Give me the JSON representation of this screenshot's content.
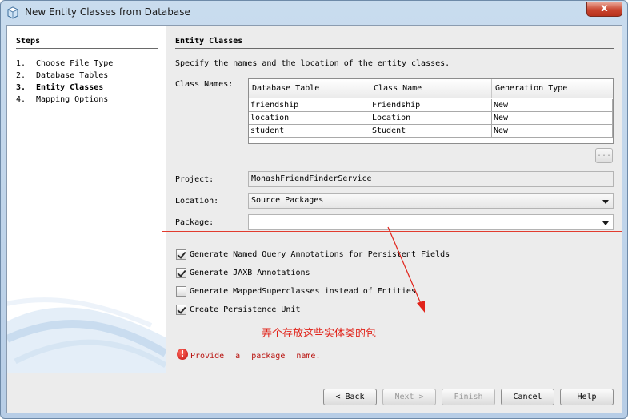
{
  "window": {
    "title": "New Entity Classes from Database",
    "close_glyph": "x"
  },
  "steps": {
    "title": "Steps",
    "items": [
      {
        "num": "1.",
        "label": "Choose File Type"
      },
      {
        "num": "2.",
        "label": "Database Tables"
      },
      {
        "num": "3.",
        "label": "Entity Classes"
      },
      {
        "num": "4.",
        "label": "Mapping Options"
      }
    ]
  },
  "panel": {
    "title": "Entity Classes",
    "instructions": "Specify the names and the location of the entity classes.",
    "class_names_label": "Class Names:",
    "table": {
      "columns": [
        "Database Table",
        "Class Name",
        "Generation Type"
      ],
      "rows": [
        [
          "friendship",
          "Friendship",
          "New"
        ],
        [
          "location",
          "Location",
          "New"
        ],
        [
          "student",
          "Student",
          "New"
        ]
      ]
    },
    "ellipsis_label": "...",
    "project_label": "Project:",
    "project_value": "MonashFriendFinderService",
    "location_label": "Location:",
    "location_value": "Source Packages",
    "package_label": "Package:",
    "package_value": "",
    "checkboxes": [
      {
        "label": "Generate Named Query Annotations for Persistent Fields",
        "checked": true
      },
      {
        "label": "Generate JAXB Annotations",
        "checked": true
      },
      {
        "label": "Generate MappedSuperclasses instead of Entities",
        "checked": false
      },
      {
        "label": "Create Persistence Unit",
        "checked": true
      }
    ],
    "annotation_text": "弄个存放这些实体类的包",
    "error_glyph": "!",
    "error_text": "Provide a package name."
  },
  "buttons": {
    "back": "< Back",
    "next": "Next >",
    "finish": "Finish",
    "cancel": "Cancel",
    "help": "Help"
  },
  "colors": {
    "highlight": "#e23b2e",
    "annotation": "#e1231a",
    "error": "#b8100c"
  }
}
